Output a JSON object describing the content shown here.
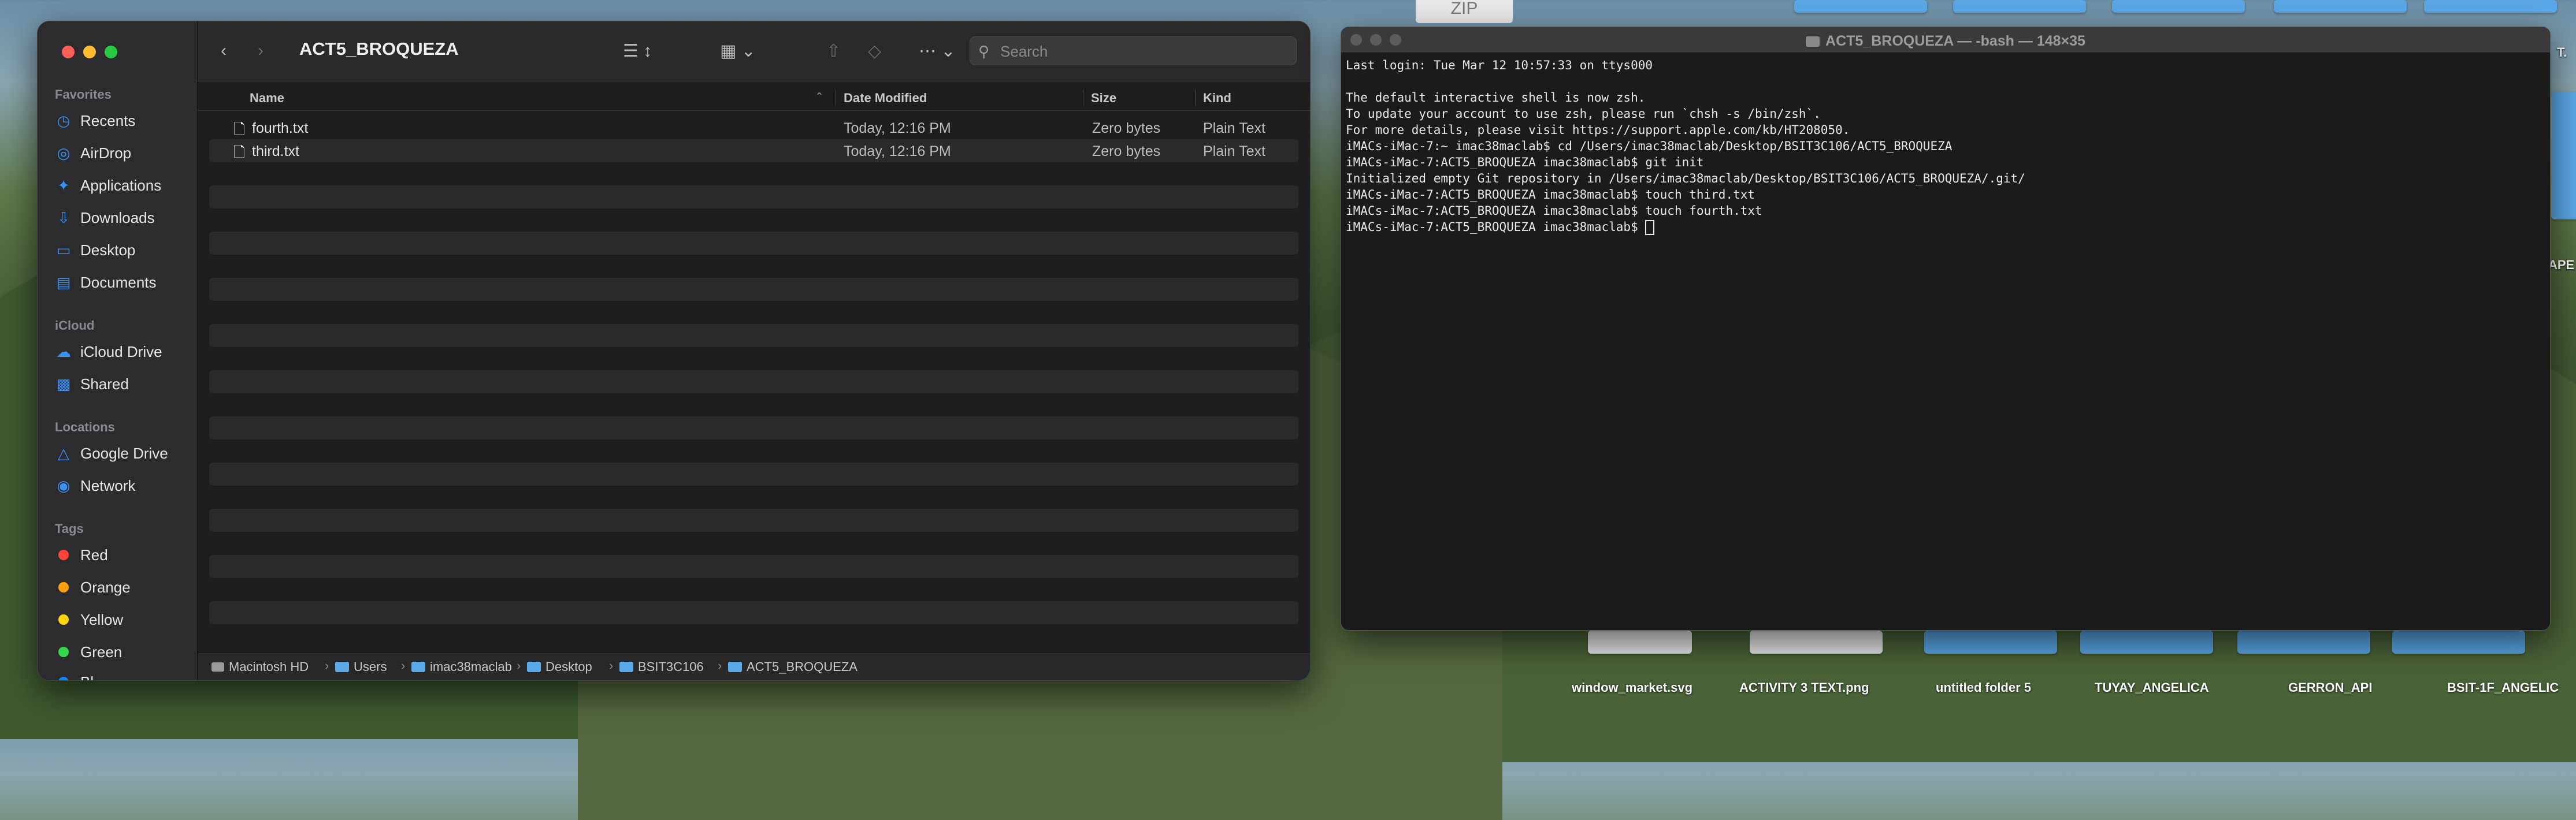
{
  "desktop": {
    "zip_label": "ZIP",
    "right_edge_labels": [
      "T.",
      "APE"
    ],
    "bottom_labels": [
      "window_market.svg",
      "ACTIVITY 3 TEXT.png",
      "untitled folder 5",
      "TUYAY_ANGELICA",
      "GERRON_API",
      "BSIT-1F_ANGELIC"
    ]
  },
  "finder": {
    "title": "ACT5_BROQUEZA",
    "search_placeholder": "Search",
    "sidebar": {
      "favorites_header": "Favorites",
      "favorites": [
        {
          "label": "Recents",
          "icon": "clock-icon"
        },
        {
          "label": "AirDrop",
          "icon": "airdrop-icon"
        },
        {
          "label": "Applications",
          "icon": "applications-icon"
        },
        {
          "label": "Downloads",
          "icon": "download-icon"
        },
        {
          "label": "Desktop",
          "icon": "desktop-icon"
        },
        {
          "label": "Documents",
          "icon": "document-icon"
        }
      ],
      "icloud_header": "iCloud",
      "icloud": [
        {
          "label": "iCloud Drive",
          "icon": "cloud-icon"
        },
        {
          "label": "Shared",
          "icon": "shared-folder-icon"
        }
      ],
      "locations_header": "Locations",
      "locations": [
        {
          "label": "Google Drive",
          "icon": "drive-icon"
        },
        {
          "label": "Network",
          "icon": "globe-icon"
        }
      ],
      "tags_header": "Tags",
      "tags": [
        {
          "label": "Red",
          "color": "#ff453a"
        },
        {
          "label": "Orange",
          "color": "#ff9f0a"
        },
        {
          "label": "Yellow",
          "color": "#ffd60a"
        },
        {
          "label": "Green",
          "color": "#32d74b"
        },
        {
          "label": "Bl",
          "color": "#0a84ff"
        }
      ]
    },
    "columns": {
      "name": "Name",
      "date": "Date Modified",
      "size": "Size",
      "kind": "Kind"
    },
    "files": [
      {
        "name": "fourth.txt",
        "date": "Today, 12:16 PM",
        "size": "Zero bytes",
        "kind": "Plain Text"
      },
      {
        "name": "third.txt",
        "date": "Today, 12:16 PM",
        "size": "Zero bytes",
        "kind": "Plain Text"
      }
    ],
    "path": [
      "Macintosh HD",
      "Users",
      "imac38maclab",
      "Desktop",
      "BSIT3C106",
      "ACT5_BROQUEZA"
    ]
  },
  "terminal": {
    "title": "ACT5_BROQUEZA — -bash — 148×35",
    "lines": [
      "Last login: Tue Mar 12 10:57:33 on ttys000",
      "",
      "The default interactive shell is now zsh.",
      "To update your account to use zsh, please run `chsh -s /bin/zsh`.",
      "For more details, please visit https://support.apple.com/kb/HT208050.",
      "iMACs-iMac-7:~ imac38maclab$ cd /Users/imac38maclab/Desktop/BSIT3C106/ACT5_BROQUEZA",
      "iMACs-iMac-7:ACT5_BROQUEZA imac38maclab$ git init",
      "Initialized empty Git repository in /Users/imac38maclab/Desktop/BSIT3C106/ACT5_BROQUEZA/.git/",
      "iMACs-iMac-7:ACT5_BROQUEZA imac38maclab$ touch third.txt",
      "iMACs-iMac-7:ACT5_BROQUEZA imac38maclab$ touch fourth.txt"
    ],
    "prompt": "iMACs-iMac-7:ACT5_BROQUEZA imac38maclab$ "
  }
}
